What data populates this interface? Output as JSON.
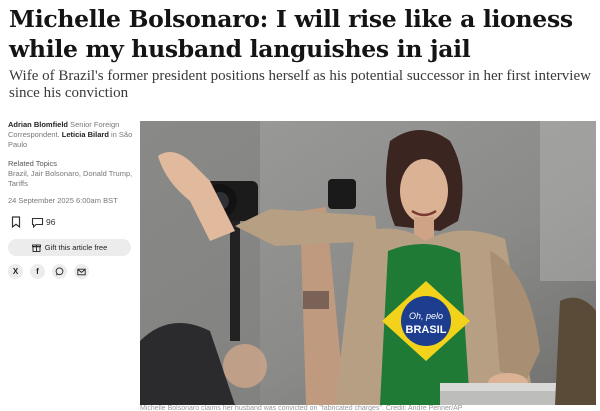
{
  "article": {
    "headline": "Michelle Bolsonaro: I will rise like a lioness while my husband languishes in jail",
    "standfirst": "Wife of Brazil's former president positions herself as his potential successor in her first interview since his conviction"
  },
  "byline": {
    "author1": "Adrian Blomfield",
    "author1_role": "Senior Foreign Correspondent.",
    "author2": "Leticia Bilard",
    "author2_location": "in São Paulo"
  },
  "topics": {
    "heading": "Related Topics",
    "list": "Brazil, Jair Bolsonaro, Donald Trump, Tariffs"
  },
  "date": "24 September 2025 6:00am BST",
  "actions": {
    "comment_count": "96",
    "gift_label": "Gift this article free"
  },
  "share": {
    "x": "X",
    "facebook": "f"
  },
  "photo": {
    "shirt_text_line1": "Oh, pelo",
    "shirt_text_line2": "BRASIL"
  },
  "caption": "Michelle Bolsonaro claims her husband was convicted on \"fabricated charges\". Credit: Andre Penner/AP",
  "colors": {
    "headline": "#141414",
    "shirt_green": "#1f7a35",
    "shirt_yellow": "#f2d21a",
    "shirt_blue": "#1d3d8f",
    "jacket": "#b79f83"
  }
}
